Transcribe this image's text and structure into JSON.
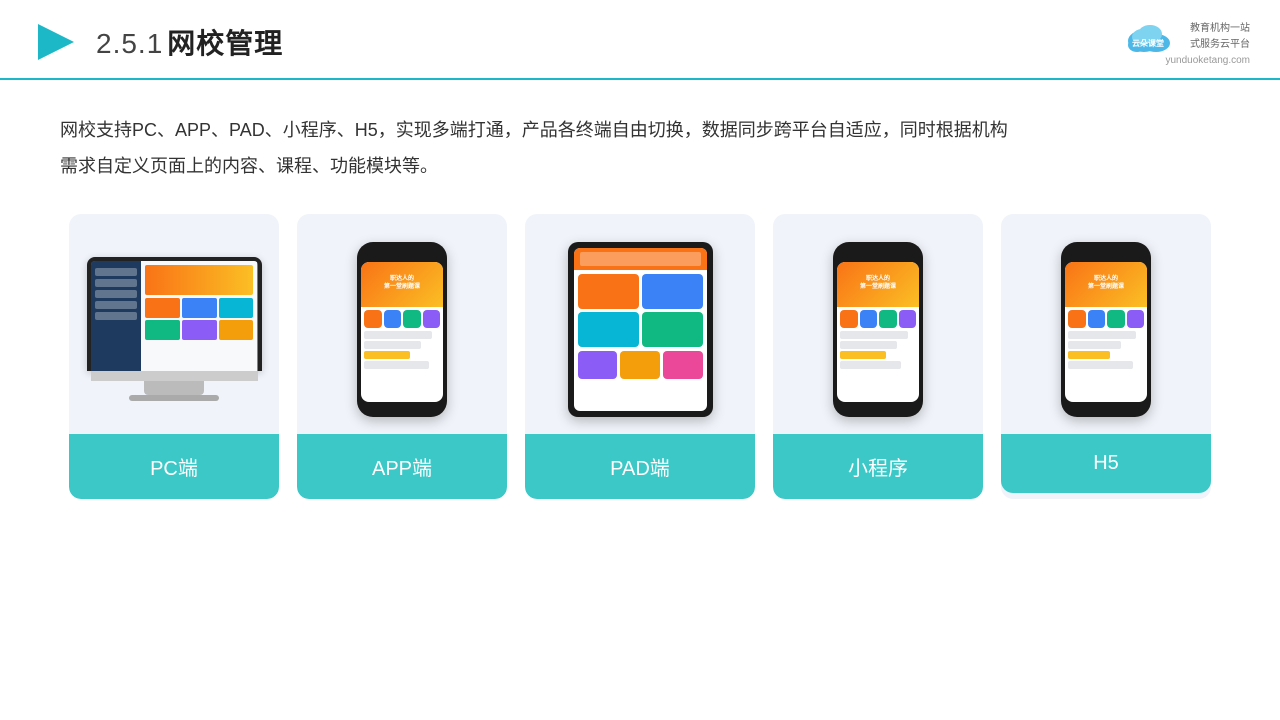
{
  "header": {
    "section": "2.5.1",
    "title": "网校管理",
    "brand_name": "云朵课堂",
    "brand_url": "yunduoketang.com",
    "brand_tagline_line1": "教育机构一站",
    "brand_tagline_line2": "式服务云平台"
  },
  "description": {
    "text_line1": "网校支持PC、APP、PAD、小程序、H5，实现多端打通，产品各终端自由切换，数据同步跨平台自适应，同时根据机构",
    "text_line2": "需求自定义页面上的内容、课程、功能模块等。"
  },
  "cards": [
    {
      "id": "pc",
      "label": "PC端",
      "type": "monitor"
    },
    {
      "id": "app",
      "label": "APP端",
      "type": "phone"
    },
    {
      "id": "pad",
      "label": "PAD端",
      "type": "tablet"
    },
    {
      "id": "miniapp",
      "label": "小程序",
      "type": "phone"
    },
    {
      "id": "h5",
      "label": "H5",
      "type": "phone"
    }
  ]
}
